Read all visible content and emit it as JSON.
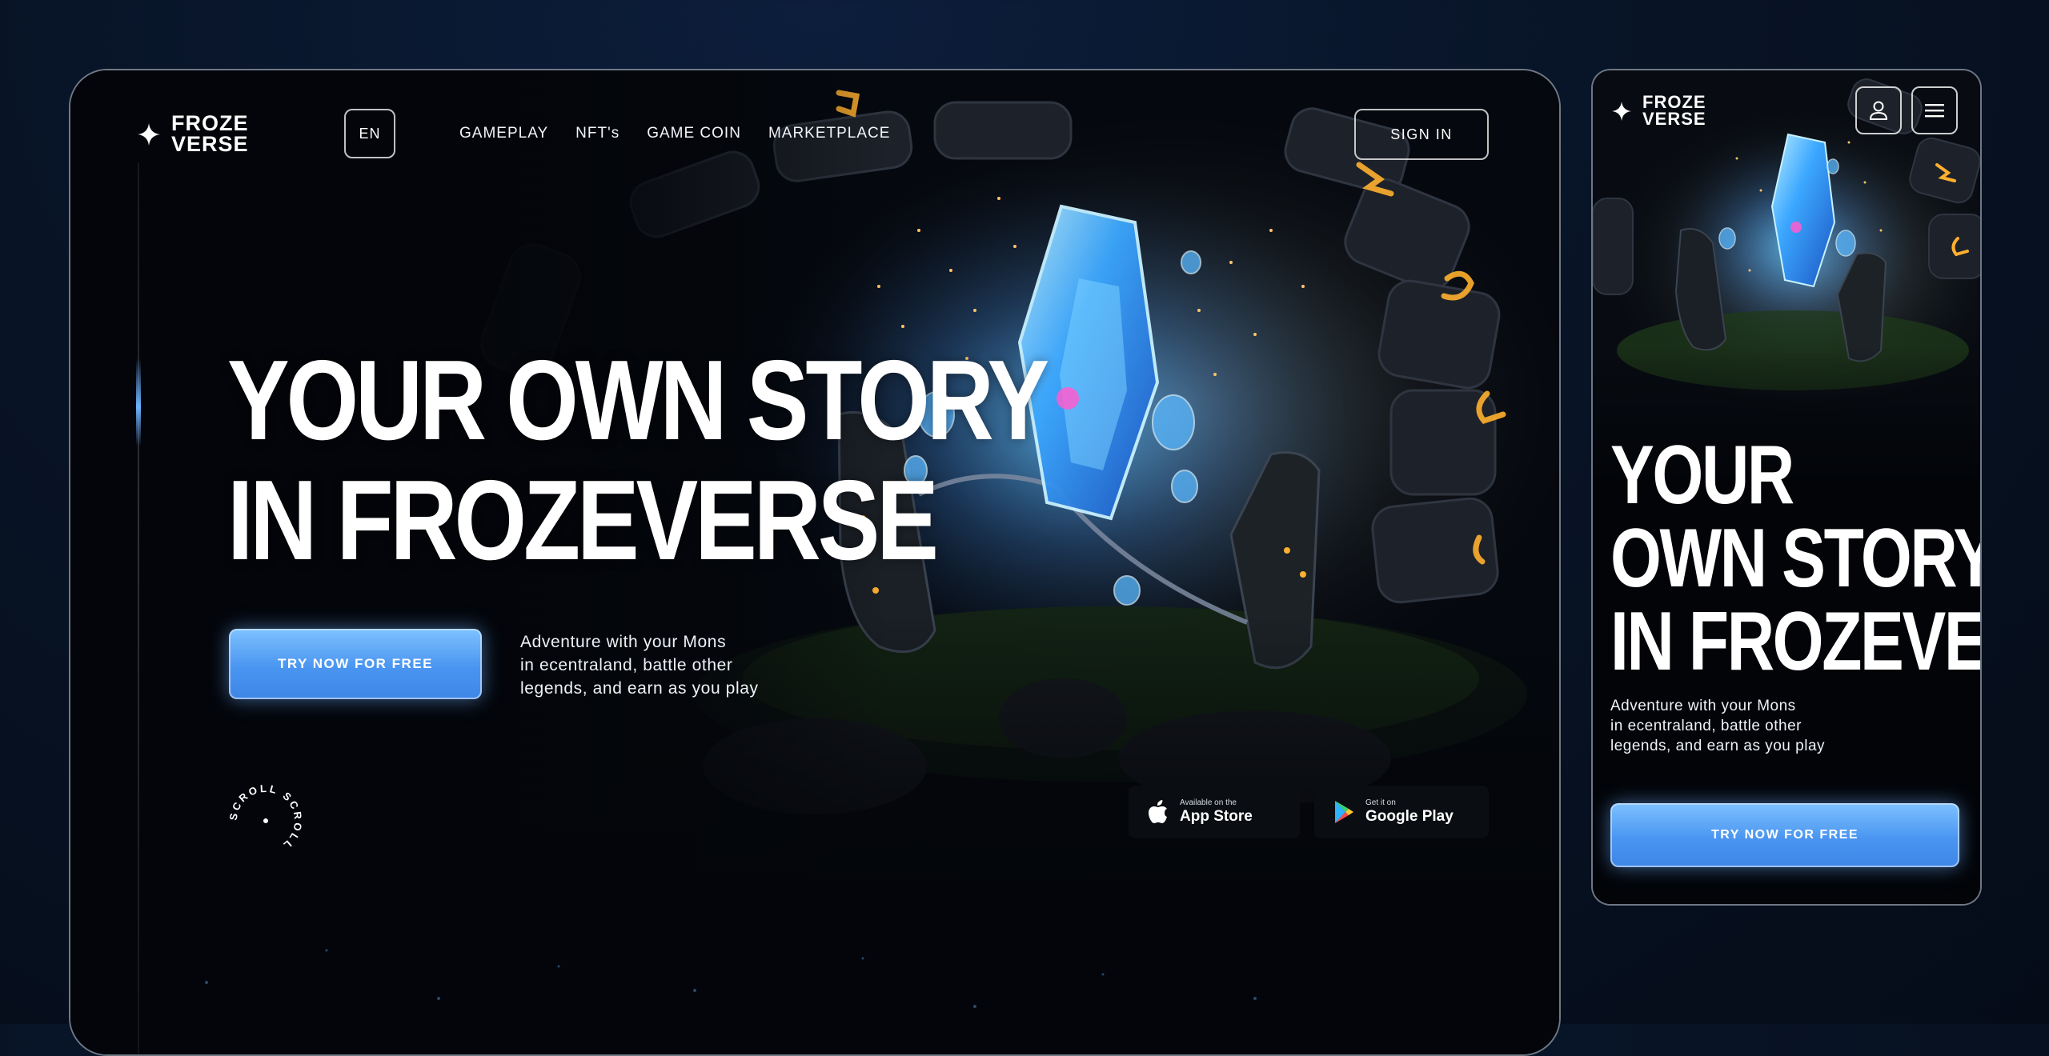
{
  "brand": {
    "line1": "FROZE",
    "line2": "VERSE"
  },
  "desktop": {
    "lang": "EN",
    "nav": [
      "GAMEPLAY",
      "NFT's",
      "GAME COIN",
      "MARKETPLACE"
    ],
    "sign_in": "SIGN IN",
    "hero": {
      "line1": "YOUR OWN STORY",
      "line2": "IN FROZEVERSE"
    },
    "cta": "TRY NOW FOR FREE",
    "lead": [
      "Adventure with your Mons",
      "in ecentraland, battle other",
      "legends, and earn as you play"
    ],
    "scroll_text": "SCROLL SCROLL",
    "stores": {
      "app_store": {
        "small": "Available on the",
        "big": "App Store",
        "icon": "apple-icon"
      },
      "google_play": {
        "small": "Get it on",
        "big": "Google Play",
        "icon": "google-play-icon"
      }
    }
  },
  "mobile": {
    "hero": {
      "line1": "YOUR",
      "line2": "OWN STORY",
      "line3": "IN FROZEVERSE"
    },
    "lead": [
      "Adventure with your Mons",
      "in ecentraland, battle other",
      "legends, and earn as you play"
    ],
    "cta": "TRY NOW FOR FREE",
    "icons": [
      "user-icon",
      "menu-icon"
    ]
  },
  "colors": {
    "background": "#081427",
    "accent_blue": "#4a95f1",
    "crystal_blue": "#39a8ff",
    "rune_orange": "#ffb02e"
  }
}
